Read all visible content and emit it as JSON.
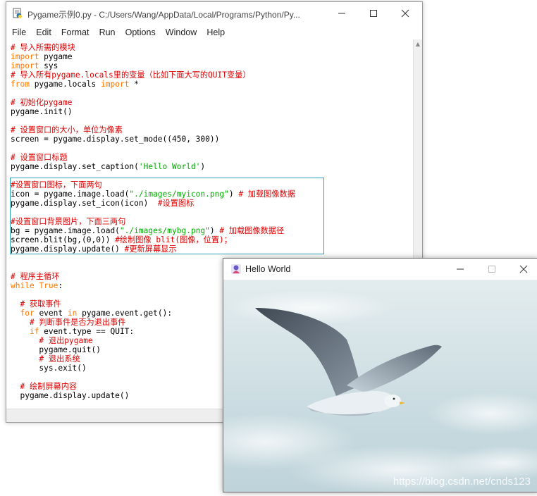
{
  "idle": {
    "title": "Pygame示例0.py - C:/Users/Wang/AppData/Local/Programs/Python/Py...",
    "menu": [
      "File",
      "Edit",
      "Format",
      "Run",
      "Options",
      "Window",
      "Help"
    ],
    "code": [
      [
        {
          "t": "# 导入所需的模块",
          "c": "comment"
        }
      ],
      [
        {
          "t": "import",
          "c": "kw"
        },
        {
          "t": " pygame",
          "c": "n"
        }
      ],
      [
        {
          "t": "import",
          "c": "kw"
        },
        {
          "t": " sys",
          "c": "n"
        }
      ],
      [
        {
          "t": "# 导入所有pygame.locals里的变量（比如下面大写的QUIT变量）",
          "c": "comment"
        }
      ],
      [
        {
          "t": "from",
          "c": "kw"
        },
        {
          "t": " pygame.locals ",
          "c": "n"
        },
        {
          "t": "import",
          "c": "kw"
        },
        {
          "t": " *",
          "c": "n"
        }
      ],
      [],
      [
        {
          "t": "# 初始化pygame",
          "c": "comment"
        }
      ],
      [
        {
          "t": "pygame.init()",
          "c": "n"
        }
      ],
      [],
      [
        {
          "t": "# 设置窗口的大小，单位为像素",
          "c": "comment"
        }
      ],
      [
        {
          "t": "screen = pygame.display.set_mode((450, 300))",
          "c": "n"
        }
      ],
      [],
      [
        {
          "t": "# 设置窗口标题",
          "c": "comment"
        }
      ],
      [
        {
          "t": "pygame.display.set_caption(",
          "c": "n"
        },
        {
          "t": "'Hello World'",
          "c": "str"
        },
        {
          "t": ")",
          "c": "n"
        }
      ],
      [],
      [
        {
          "t": "#设置窗口图标，下面两句",
          "c": "comment"
        }
      ],
      [
        {
          "t": "icon = pygame.image.load(",
          "c": "n"
        },
        {
          "t": "\"./images/myicon.png\"",
          "c": "str"
        },
        {
          "t": ") ",
          "c": "n"
        },
        {
          "t": "# 加载图像数据",
          "c": "comment"
        }
      ],
      [
        {
          "t": "pygame.display.set_icon(icon)  ",
          "c": "n"
        },
        {
          "t": "#设置图标",
          "c": "comment"
        }
      ],
      [],
      [
        {
          "t": "#设置窗口背景图片，下面三两句",
          "c": "comment"
        }
      ],
      [
        {
          "t": "bg = pygame.image.load(",
          "c": "n"
        },
        {
          "t": "\"./images/mybg.png\"",
          "c": "str"
        },
        {
          "t": ") ",
          "c": "n"
        },
        {
          "t": "# 加载图像数据径",
          "c": "comment"
        }
      ],
      [
        {
          "t": "screen.blit(bg,(0,0)) ",
          "c": "n"
        },
        {
          "t": "#绘制图像 blit(图像，位置)；",
          "c": "comment"
        }
      ],
      [
        {
          "t": "pygame.display.update() ",
          "c": "n"
        },
        {
          "t": "#更新屏幕显示",
          "c": "comment"
        }
      ],
      [],
      [],
      [
        {
          "t": "# 程序主循环",
          "c": "comment"
        }
      ],
      [
        {
          "t": "while",
          "c": "kw"
        },
        {
          "t": " ",
          "c": "n"
        },
        {
          "t": "True",
          "c": "kw"
        },
        {
          "t": ":",
          "c": "n"
        }
      ],
      [],
      [
        {
          "t": "  # 获取事件",
          "c": "comment"
        }
      ],
      [
        {
          "t": "  ",
          "c": "n"
        },
        {
          "t": "for",
          "c": "kw"
        },
        {
          "t": " event ",
          "c": "n"
        },
        {
          "t": "in",
          "c": "kw"
        },
        {
          "t": " pygame.event.get():",
          "c": "n"
        }
      ],
      [
        {
          "t": "    # 判断事件是否为退出事件",
          "c": "comment"
        }
      ],
      [
        {
          "t": "    ",
          "c": "n"
        },
        {
          "t": "if",
          "c": "kw"
        },
        {
          "t": " event.type == QUIT:",
          "c": "n"
        }
      ],
      [
        {
          "t": "      # 退出pygame",
          "c": "comment"
        }
      ],
      [
        {
          "t": "      pygame.quit()",
          "c": "n"
        }
      ],
      [
        {
          "t": "      # 退出系统",
          "c": "comment"
        }
      ],
      [
        {
          "t": "      sys.exit()",
          "c": "n"
        }
      ],
      [],
      [
        {
          "t": "  # 绘制屏幕内容",
          "c": "comment"
        }
      ],
      [
        {
          "t": "  pygame.display.update()",
          "c": "n"
        }
      ]
    ]
  },
  "pygame_window": {
    "title": "Hello World"
  },
  "watermark": "https://blog.csdn.net/cnds123",
  "colors": {
    "comment": "#dd0000",
    "keyword": "#ff7700",
    "string": "#00aa00",
    "selection_border": "#29a3b5"
  },
  "icons": {
    "idle_app": "python-idle-icon",
    "pygame_app": "pygame-icon",
    "minimize": "minimize-icon",
    "maximize": "maximize-icon",
    "close": "close-icon"
  }
}
